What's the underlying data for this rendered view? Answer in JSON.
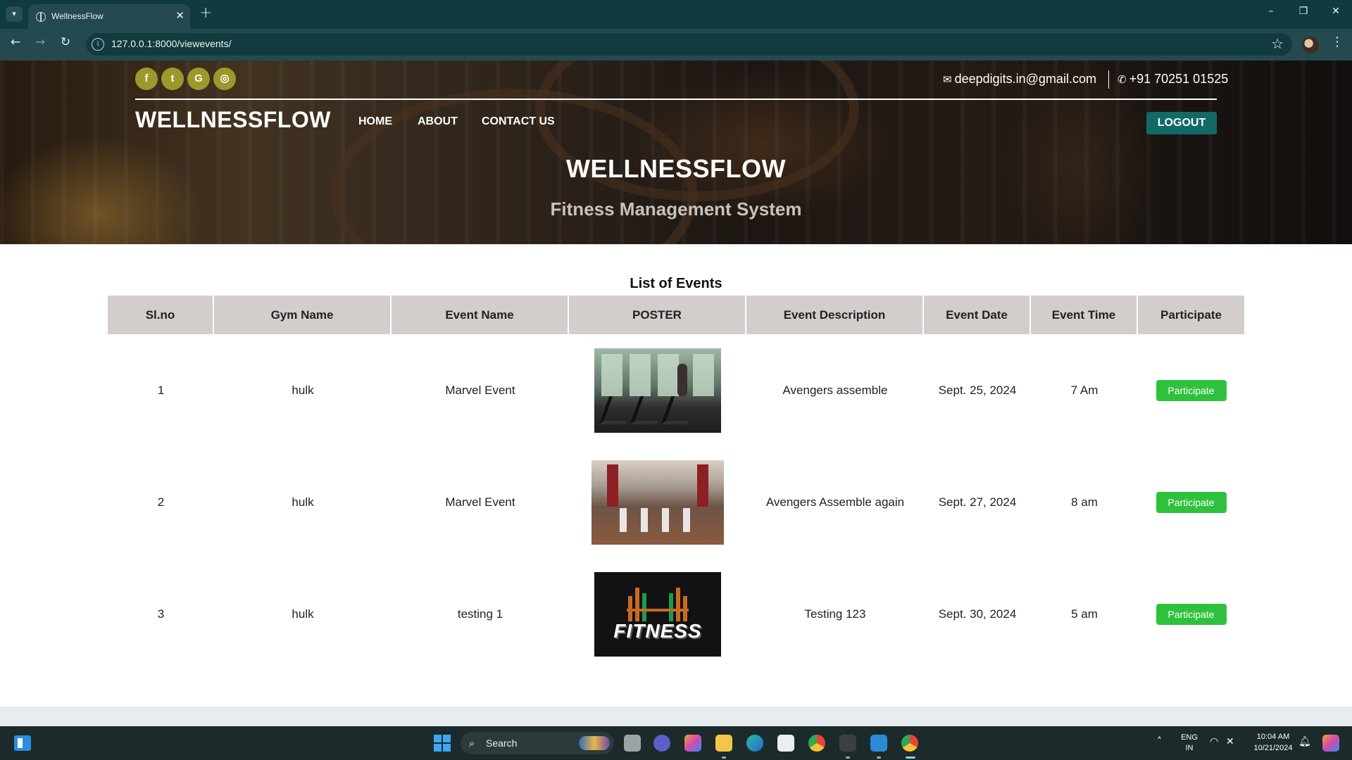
{
  "browser": {
    "tab_title": "WellnessFlow",
    "url": "127.0.0.1:8000/viewevents/",
    "tab_list_icon": "chevron-down-icon",
    "window_controls": [
      "–",
      "❐",
      "✕"
    ]
  },
  "header": {
    "social_icons": [
      "facebook-icon",
      "twitter-icon",
      "google-icon",
      "instagram-icon"
    ],
    "email": "deepdigits.in@gmail.com",
    "phone": "+91 70251 01525",
    "brand": "WELLNESSFLOW",
    "nav": [
      "HOME",
      "ABOUT",
      "CONTACT US"
    ],
    "logout_label": "LOGOUT",
    "hero_title": "WELLNESSFLOW",
    "hero_subtitle": "Fitness Management System"
  },
  "events": {
    "title": "List of Events",
    "columns": [
      "Sl.no",
      "Gym Name",
      "Event Name",
      "POSTER",
      "Event Description",
      "Event Date",
      "Event Time",
      "Participate"
    ],
    "rows": [
      {
        "slno": "1",
        "gym": "hulk",
        "event": "Marvel Event",
        "poster": "treadmill gym photo",
        "description": "Avengers assemble",
        "date": "Sept. 25, 2024",
        "time": "7 Am",
        "action": "Participate"
      },
      {
        "slno": "2",
        "gym": "hulk",
        "event": "Marvel Event",
        "poster": "gym interior photo",
        "description": "Avengers Assemble again",
        "date": "Sept. 27, 2024",
        "time": "8 am",
        "action": "Participate"
      },
      {
        "slno": "3",
        "gym": "hulk",
        "event": "testing 1",
        "poster": "fitness barbell logo",
        "description": "Testing 123",
        "date": "Sept. 30, 2024",
        "time": "5 am",
        "action": "Participate"
      }
    ],
    "poster3_text": "FITNESS"
  },
  "taskbar": {
    "search_placeholder": "Search",
    "language": "ENG",
    "region": "IN",
    "time": "10:04 AM",
    "date": "10/21/2024"
  },
  "colors": {
    "logout_bg": "#126966",
    "participate_bg": "#2fc13c",
    "table_header_bg": "#d3cdcc",
    "social_bg": "#9a9a2a"
  }
}
